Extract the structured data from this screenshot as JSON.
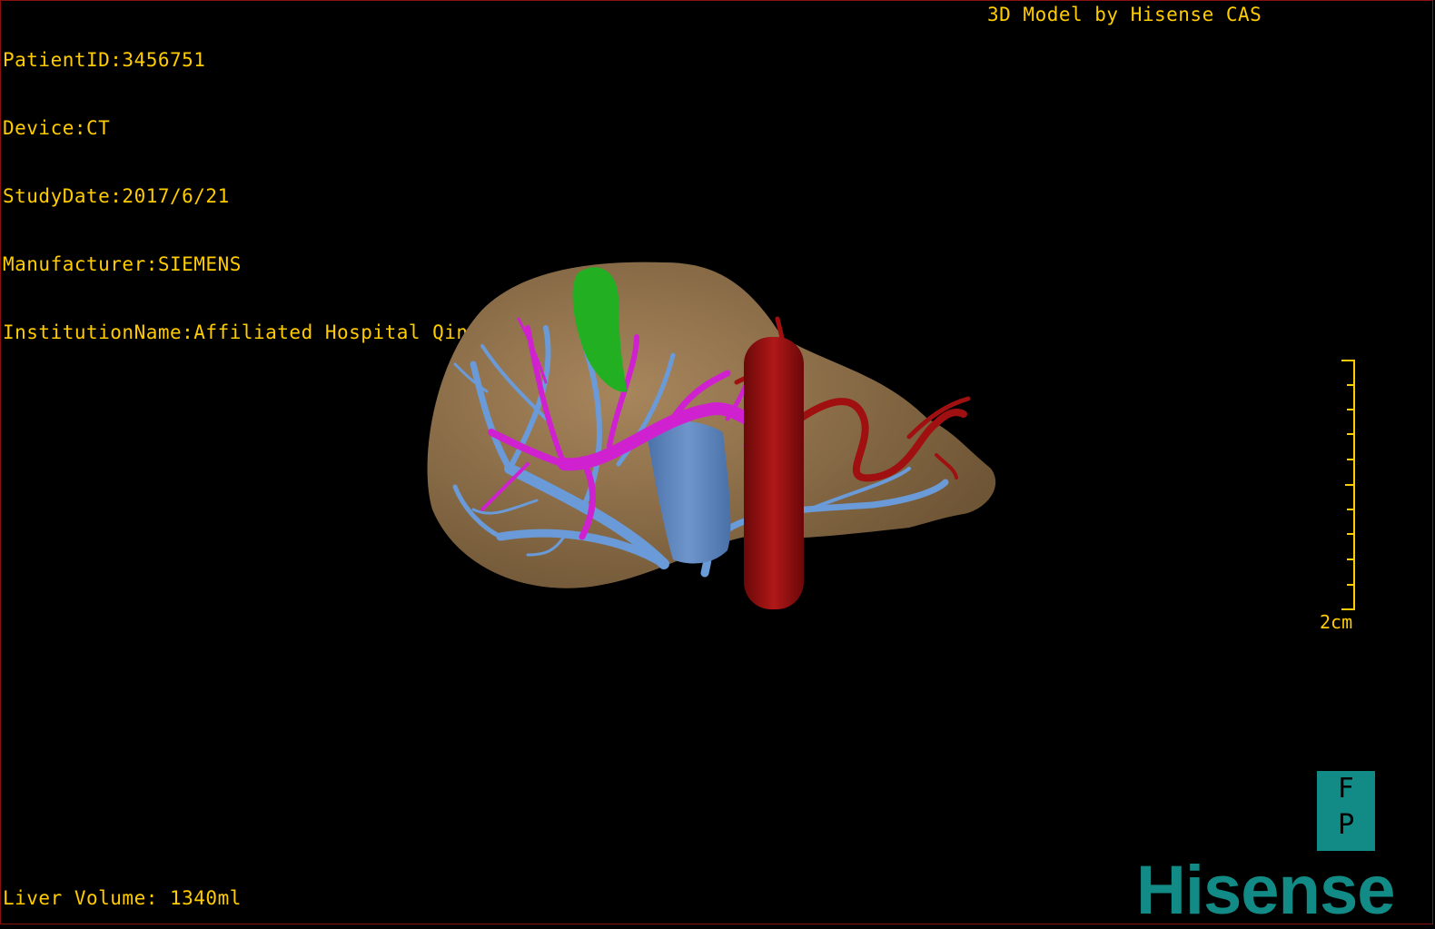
{
  "study": {
    "patient_id": "PatientID:3456751",
    "device": "Device:CT",
    "study_date": "StudyDate:2017/6/21",
    "manufacturer": "Manufacturer:SIEMENS",
    "institution": "InstitutionName:Affiliated Hospital Qingdao University-C"
  },
  "credit": "3D Model by Hisense CAS",
  "liver_volume": "Liver Volume: 1340ml",
  "scale": {
    "label": "2cm"
  },
  "orientation": {
    "top": "F",
    "bottom": "P"
  },
  "brand": "Hisense",
  "colors": {
    "overlay_text": "#ffcc00",
    "liver": "#9a7a52",
    "hepatic_vein": "#6a9ad8",
    "portal_vein": "#d021d0",
    "artery": "#a01010",
    "gallbladder": "#22b022",
    "brand": "#128a86",
    "frame": "#8a1010"
  },
  "model_parts": [
    "liver",
    "hepatic-vein",
    "portal-vein",
    "artery",
    "gallbladder",
    "ivc"
  ]
}
